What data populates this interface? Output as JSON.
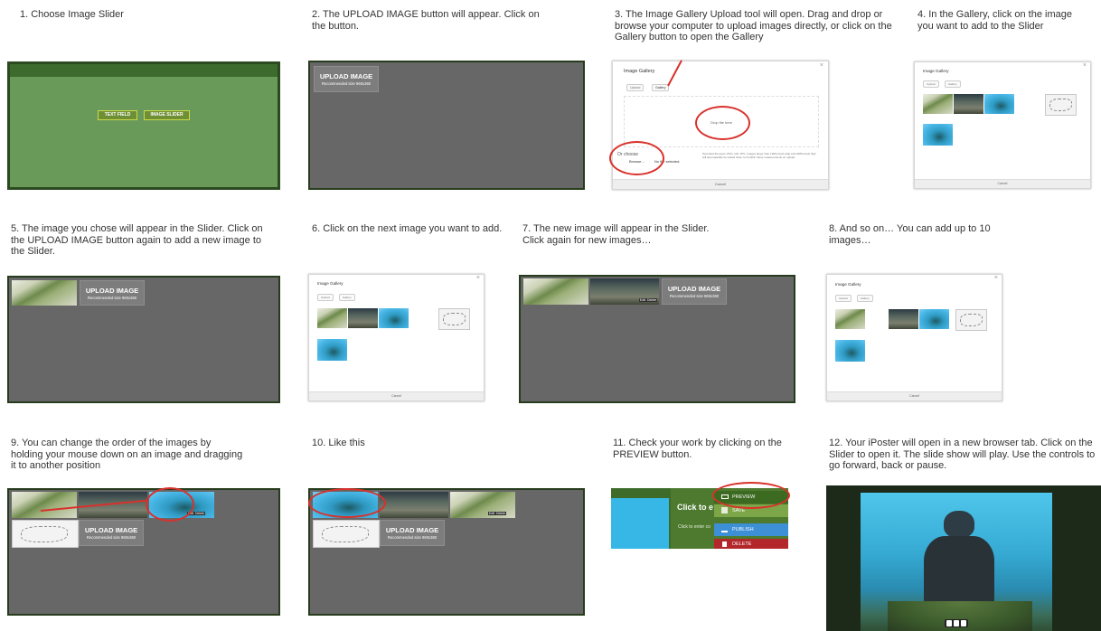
{
  "steps": [
    {
      "caption": "1. Choose Image Slider"
    },
    {
      "caption": "2. The UPLOAD IMAGE button will appear. Click on the button."
    },
    {
      "caption": "3. The Image Gallery Upload tool will open. Drag and drop or browse your computer to upload images directly, or click on the Gallery button to open the Gallery"
    },
    {
      "caption": "4. In the Gallery, click on the image you want to add to the Slider"
    },
    {
      "caption": "5. The image you chose will appear in the Slider. Click on the UPLOAD IMAGE button again to add a new image to the Slider."
    },
    {
      "caption": "6. Click on the next image you want to add."
    },
    {
      "caption": "7. The new image will appear in the Slider. Click again for new images…"
    },
    {
      "caption": "8. And so on… You can add up to 10 images…"
    },
    {
      "caption": "9. You can change the order of the images by holding your mouse down on an image and dragging it to another position"
    },
    {
      "caption": "10. Like this"
    },
    {
      "caption": "11. Check your work by clicking on the PREVIEW button."
    },
    {
      "caption": "12. Your iPoster will open in a new browser tab. Click on the Slider to open it. The slide show will play. Use the controls to go forward, back or pause."
    }
  ],
  "chooser": {
    "text_field": "TEXT FIELD",
    "image_slider": "IMAGE SLIDER"
  },
  "upload": {
    "label": "UPLOAD IMAGE",
    "hint": "Recommended size 960x360"
  },
  "gallery": {
    "title": "Image Gallery",
    "tab_upload": "Upload",
    "tab_gallery": "Gallery",
    "close": "×",
    "drop": "Drop file here",
    "or_choose": "Or choose",
    "browse": "Browse...",
    "no_file": "No file selected.",
    "note": "Permitted file types: PNG, GIF, JPG. Images larger than 1920 pixels wide and 1080 pixels high will automatically be scaled down to fit within these measurements on upload.",
    "cancel": "Cancel",
    "edit": "Edit",
    "delete": "Delete"
  },
  "toolbar": {
    "click_to": "Click to e",
    "click_to_enter": "Click to enter co",
    "preview": "PREVIEW",
    "save": "SAVE",
    "publish": "PUBLISH",
    "delete": "DELETE"
  },
  "colors": {
    "slider_green": "#6a9a5a",
    "panel_gray": "#676767",
    "border_green": "#263c1c",
    "annotation_red": "#d9312b",
    "preview_green": "#4d7a2e",
    "publish_blue": "#3d8fd6",
    "delete_red": "#b3262a"
  }
}
